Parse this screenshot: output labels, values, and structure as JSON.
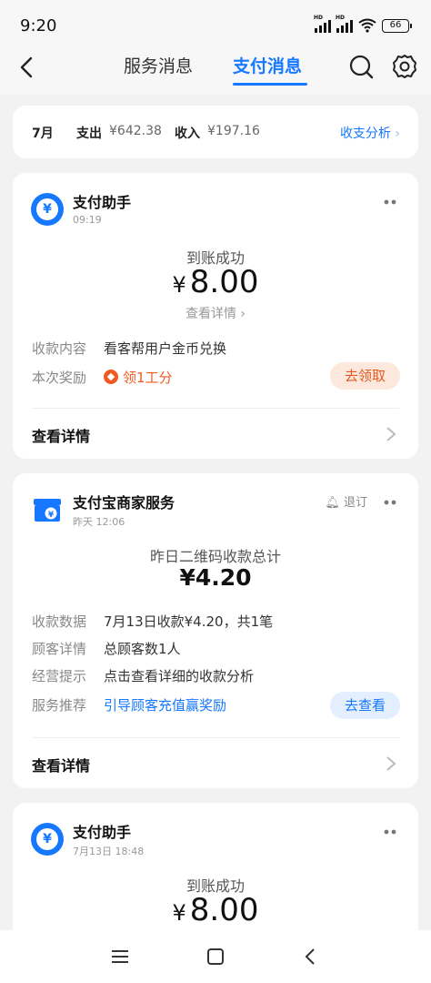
{
  "status_bar": {
    "time": "9:20",
    "battery": "66",
    "hd": "HD"
  },
  "header": {
    "tab_service": "服务消息",
    "tab_payment": "支付消息"
  },
  "summary": {
    "month": "7月",
    "expense_label": "支出",
    "expense_value": "¥642.38",
    "income_label": "收入",
    "income_value": "¥197.16",
    "analysis_link": "收支分析"
  },
  "card1": {
    "title": "支付助手",
    "time": "09:19",
    "status": "到账成功",
    "currency": "¥",
    "amount": "8.00",
    "detail_link": "查看详情",
    "rows": [
      {
        "key": "收款内容",
        "value": "看客帮用户金币兑换"
      },
      {
        "key": "本次奖励",
        "value": "领1工分"
      }
    ],
    "action": "去领取",
    "view_detail": "查看详情"
  },
  "card2": {
    "title": "支付宝商家服务",
    "time": "昨天 12:06",
    "unsubscribe": "退订",
    "status": "昨日二维码收款总计",
    "amount": "¥4.20",
    "rows": [
      {
        "key": "收款数据",
        "value": "7月13日收款¥4.20，共1笔"
      },
      {
        "key": "顾客详情",
        "value": "总顾客数1人"
      },
      {
        "key": "经营提示",
        "value": "点击查看详细的收款分析"
      },
      {
        "key": "服务推荐",
        "value": "引导顾客充值赢奖励"
      }
    ],
    "action": "去查看",
    "view_detail": "查看详情"
  },
  "card3": {
    "title": "支付助手",
    "time": "7月13日 18:48",
    "status": "到账成功",
    "currency": "¥",
    "amount": "8.00"
  },
  "icons": {
    "yuan": "¥"
  },
  "colors": {
    "accent": "#1677ff",
    "reward": "#f15a22"
  }
}
